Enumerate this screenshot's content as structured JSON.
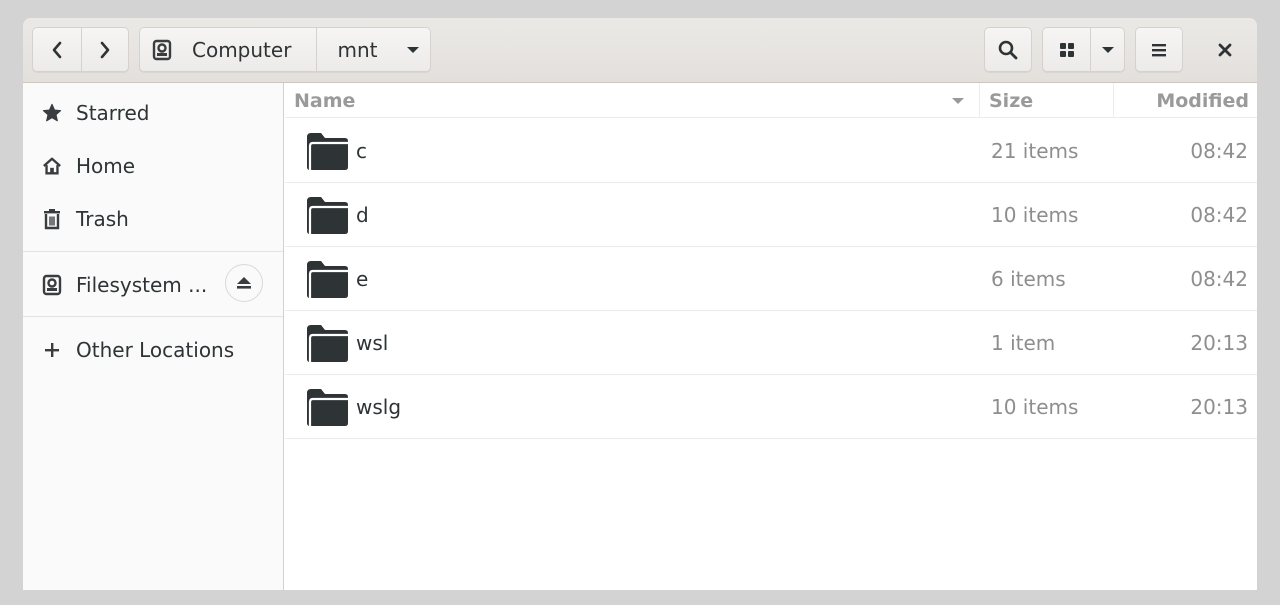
{
  "headerbar": {
    "back_icon": "chevron-left-icon",
    "forward_icon": "chevron-right-icon",
    "path": [
      {
        "label": "Computer",
        "icon": "drive-icon"
      },
      {
        "label": "mnt",
        "icon": "chevron-down-icon"
      }
    ],
    "search_icon": "search-icon",
    "view_icon": "grid-view-icon",
    "view_options_icon": "chevron-down-icon",
    "menu_icon": "hamburger-menu-icon",
    "close_icon": "close-icon"
  },
  "sidebar": {
    "items": [
      {
        "label": "Starred",
        "icon": "star-icon"
      },
      {
        "label": "Home",
        "icon": "home-icon"
      },
      {
        "label": "Trash",
        "icon": "trash-icon"
      },
      {
        "label": "Filesystem ...",
        "icon": "drive-icon",
        "action_icon": "eject-icon"
      },
      {
        "label": "Other Locations",
        "icon": "plus-icon"
      }
    ]
  },
  "list": {
    "columns": {
      "name": "Name",
      "size": "Size",
      "modified": "Modified"
    },
    "sort_indicator": "sort-descending-icon",
    "rows": [
      {
        "name": "c",
        "size": "21 items",
        "modified": "08:42",
        "icon": "folder-icon"
      },
      {
        "name": "d",
        "size": "10 items",
        "modified": "08:42",
        "icon": "folder-icon"
      },
      {
        "name": "e",
        "size": "6 items",
        "modified": "08:42",
        "icon": "folder-icon"
      },
      {
        "name": "wsl",
        "size": "1 item",
        "modified": "20:13",
        "icon": "folder-icon"
      },
      {
        "name": "wslg",
        "size": "10 items",
        "modified": "20:13",
        "icon": "folder-icon"
      }
    ]
  },
  "colors": {
    "window_bg": "#ffffff",
    "sidebar_bg": "#fafafa",
    "headerbar_bg": "#e8e6e3",
    "desktop_bg": "#d3d3d3",
    "text": "#2e3436",
    "muted_text": "#8e8e8e"
  }
}
